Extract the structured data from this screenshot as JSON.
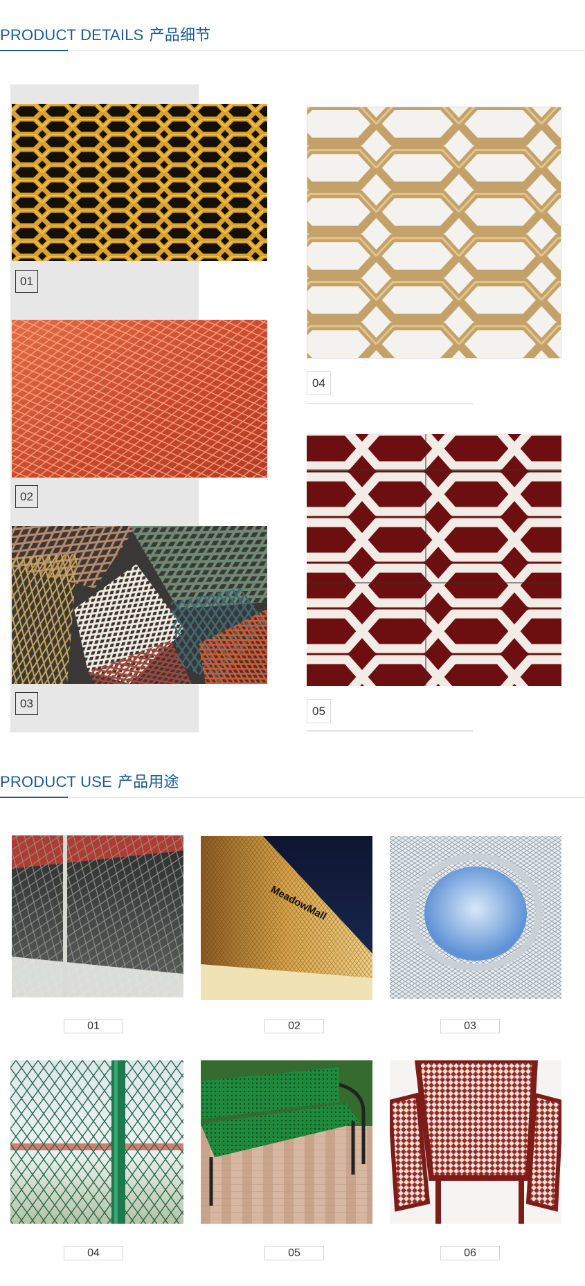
{
  "details_section": {
    "title_en": "PRODUCT DETAILS",
    "title_cn": "产品细节",
    "items": [
      {
        "number": "01"
      },
      {
        "number": "02"
      },
      {
        "number": "03"
      },
      {
        "number": "04"
      },
      {
        "number": "05"
      }
    ]
  },
  "use_section": {
    "title_en": "PRODUCT USE",
    "title_cn": "产品用途",
    "items": [
      {
        "number": "01"
      },
      {
        "number": "02",
        "sign_text": "MeadowMall"
      },
      {
        "number": "03"
      },
      {
        "number": "04"
      },
      {
        "number": "05"
      },
      {
        "number": "06"
      }
    ]
  },
  "colors": {
    "accent_blue": "#1a5a96",
    "panel_grey": "#e7e7e7"
  }
}
